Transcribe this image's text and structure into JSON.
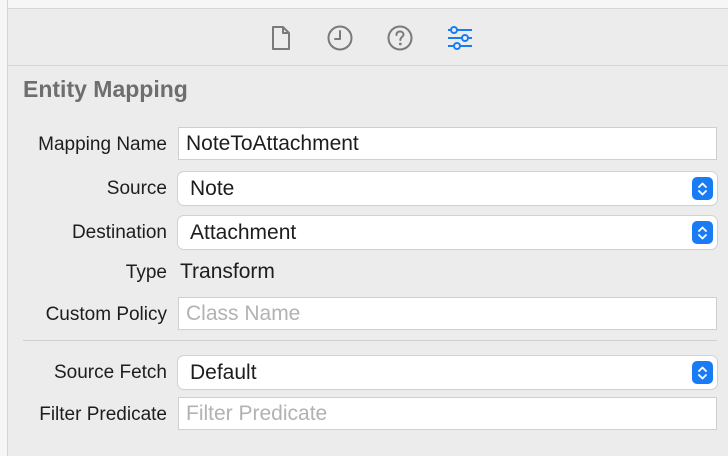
{
  "toolbar": {
    "icons": [
      "file-inspector-icon",
      "history-inspector-icon",
      "quick-help-icon",
      "attributes-inspector-icon"
    ],
    "accent_color": "#1a7cf5",
    "icon_color": "#7a7a7a"
  },
  "section": {
    "title": "Entity Mapping"
  },
  "form": {
    "mapping_name": {
      "label": "Mapping Name",
      "value": "NoteToAttachment"
    },
    "source": {
      "label": "Source",
      "value": "Note"
    },
    "destination": {
      "label": "Destination",
      "value": "Attachment"
    },
    "type": {
      "label": "Type",
      "value": "Transform"
    },
    "custom_policy": {
      "label": "Custom Policy",
      "value": "",
      "placeholder": "Class Name"
    },
    "source_fetch": {
      "label": "Source Fetch",
      "value": "Default"
    },
    "filter_predicate": {
      "label": "Filter Predicate",
      "value": "",
      "placeholder": "Filter Predicate"
    }
  }
}
